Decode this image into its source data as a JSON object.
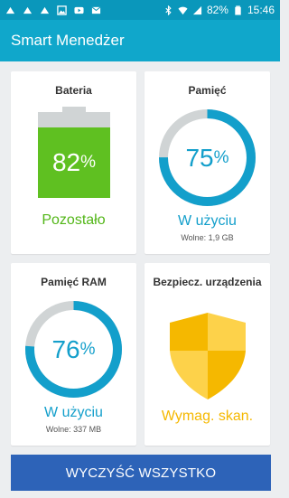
{
  "statusbar": {
    "icons_left": [
      "notification-icon",
      "notification-icon",
      "notification-icon",
      "image-icon",
      "youtube-icon",
      "message-icon"
    ],
    "icons_right": [
      "bluetooth-icon",
      "wifi-icon",
      "signal-icon"
    ],
    "battery": "82%",
    "time": "15:46"
  },
  "appbar": {
    "title": "Smart Menedżer"
  },
  "battery": {
    "title": "Bateria",
    "value": "82",
    "unit": "%",
    "status": "Pozostało",
    "level": 0.82
  },
  "storage": {
    "title": "Pamięć",
    "value": "75",
    "unit": "%",
    "status": "W użyciu",
    "free": "Wolne: 1,9 GB",
    "used_fraction": 0.75
  },
  "ram": {
    "title": "Pamięć RAM",
    "value": "76",
    "unit": "%",
    "status": "W użyciu",
    "free": "Wolne: 337 MB",
    "used_fraction": 0.76
  },
  "security": {
    "title": "Bezpiecz. urządzenia",
    "status": "Wymag. skan."
  },
  "actions": {
    "clear_label": "WYCZYŚĆ WSZYSTKO"
  },
  "colors": {
    "accent": "#10a7cb",
    "ring": "#139fcb",
    "ring_track": "#d0d4d5",
    "battery_fill": "#5fc021",
    "shield": "#f5b800",
    "button": "#2d63b8"
  }
}
